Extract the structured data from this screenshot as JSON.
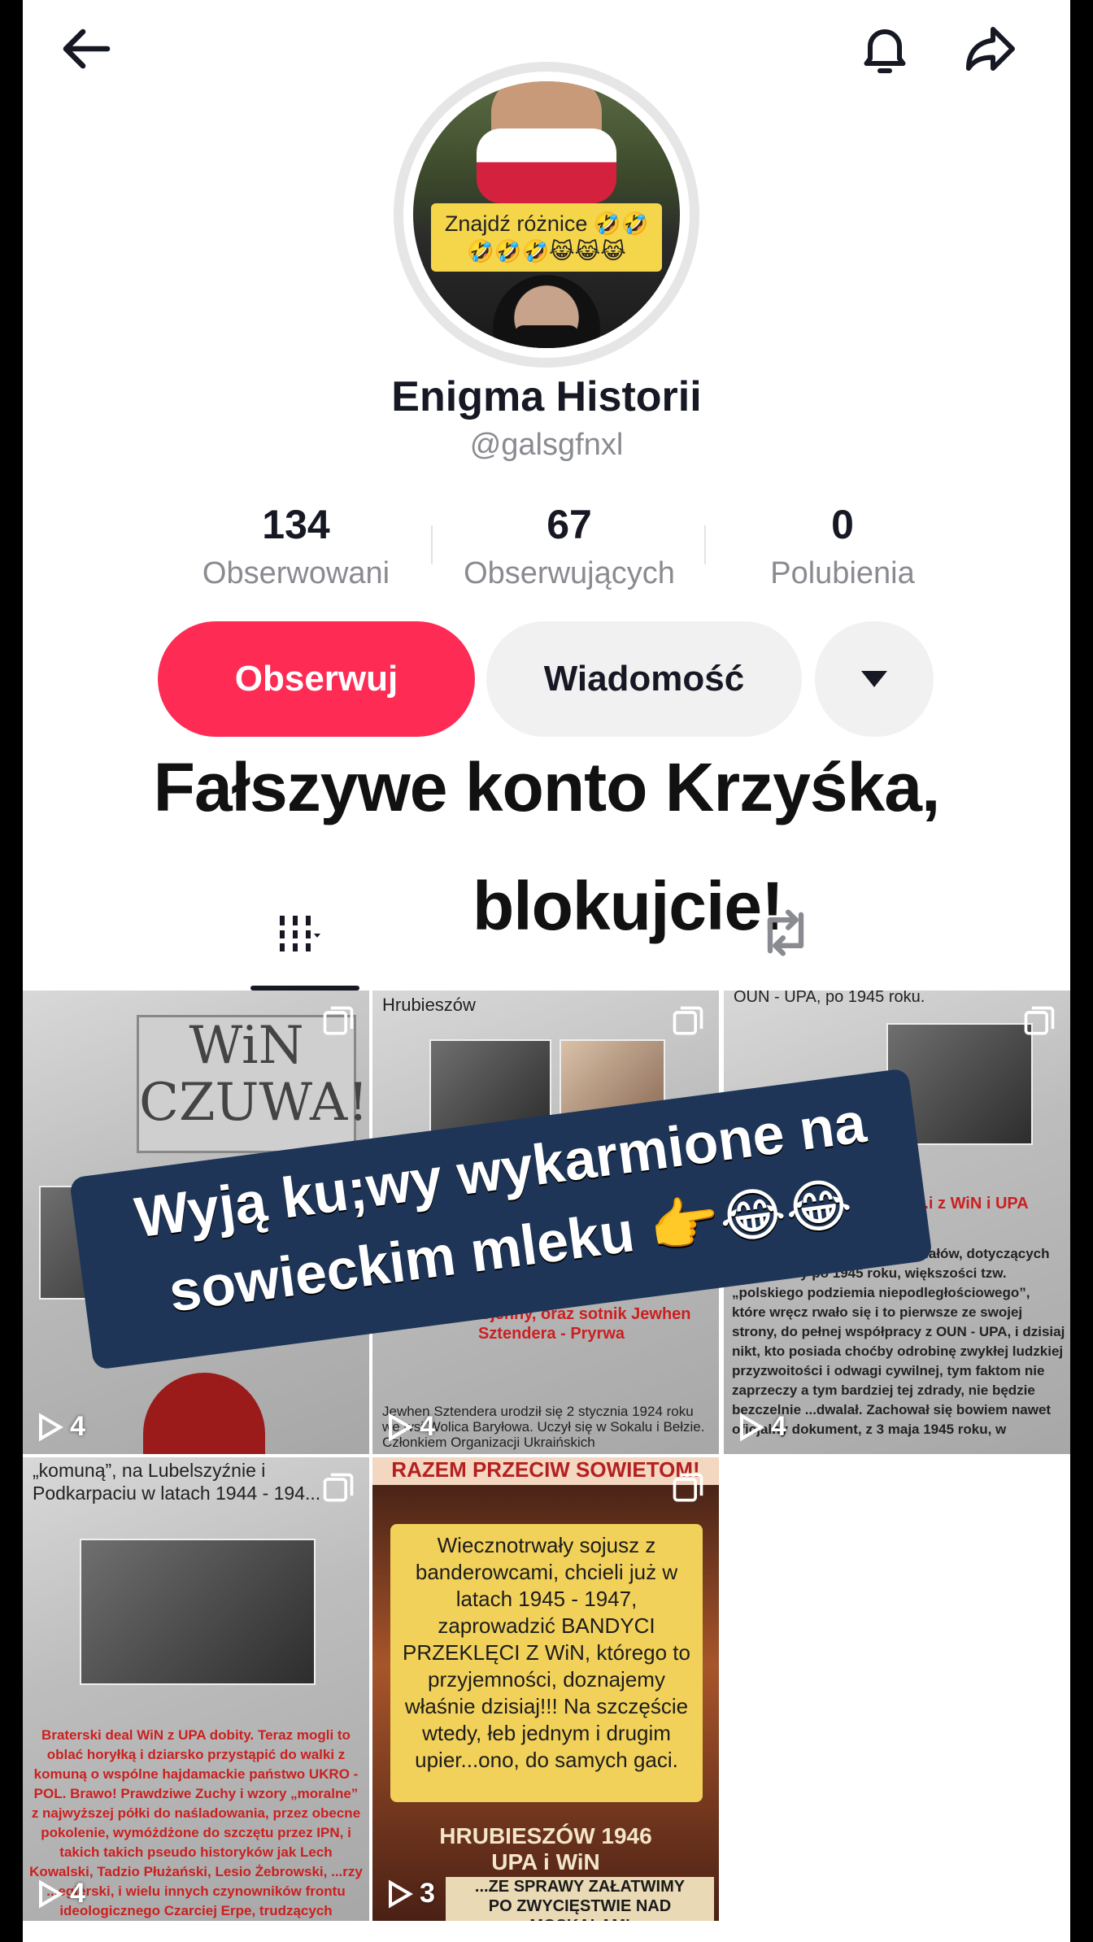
{
  "header": {
    "back_icon": "arrow-left-icon",
    "bell_icon": "bell-icon",
    "share_icon": "share-arrow-icon"
  },
  "profile": {
    "name": "Enigma Historii",
    "handle": "@galsgfnxl",
    "avatar_caption_line1": "Znajdź różnice 🤣🤣",
    "avatar_caption_line2": "🤣🤣🤣😹😹😹"
  },
  "stats": [
    {
      "value": "134",
      "label": "Obserwowani"
    },
    {
      "value": "67",
      "label": "Obserwujących"
    },
    {
      "value": "0",
      "label": "Polubienia"
    }
  ],
  "actions": {
    "follow_label": "Obserwuj",
    "message_label": "Wiadomość",
    "more_icon": "triangle-down-icon"
  },
  "bio_overlay": {
    "line1": "Fałszywe konto Krzyśka,",
    "line2": "blokujcie!"
  },
  "tabs": {
    "videos_icon": "grid-icon",
    "repost_icon": "repost-icon"
  },
  "caption_overlay": {
    "line1": "Wyją ku;wy wykarmione na",
    "line2": "sowieckim mleku 👉😂😂"
  },
  "videos": [
    {
      "count": "4",
      "sign_text": "WiN CZUWA!",
      "text": ""
    },
    {
      "count": "4",
      "top_text": "Hrubieszów",
      "red_text": "...marz wojenny, oraz sotnik Jewhen Sztendera - Pryrwa",
      "text": "Jewhen Sztendera urodził się 2 stycznia 1924 roku we wsi Wolica Baryłowa. Uczył się w Sokalu i Bełzie. Członkiem Organizacji Ukraińskich"
    },
    {
      "count": "4",
      "top_text": "OUN - UPA, po 1945 roku.",
      "red_text": "...i z WiN i UPA",
      "text": "...kerecie jest mnóstwo materiałów, dotyczących współpracy po 1945 roku, większości tzw. „polskiego podziemia niepodległościowego”, które wręcz rwało się i to pierwsze ze swojej strony, do pełnej współpracy z OUN - UPA, i dzisiaj nikt, kto posiada choćby odrobinę zwykłej ludzkiej przyzwoitości i odwagi cywilnej, tym faktom nie zaprzeczy a tym bardziej tej zdrady, nie będzie bezczelnie ...dwalał. Zachował się bowiem nawet oficjalny dokument, z 3 maja 1945 roku, w"
    },
    {
      "count": "4",
      "top_text": "„komuną”, na Lubelszyźnie i Podkarpaciu w latach 1944 - 194...",
      "red_text": "Braterski deal WiN z UPA dobity. Teraz mogli to oblać horyłką i dziarsko przystąpić do walki z komuną o wspólne hajdamackie państwo UKRO - POL. Brawo! Prawdziwe Zuchy i wzory „moralne” z najwyższej półki do naśladowania, przez obecne pokolenie, wymóżdżone do szczętu przez IPN, i takich takich pseudo historyków jak Lech Kowalski, Tadzio Płużański, Lesio Żebrowski, ...rzy ...egierski, i wielu innych czynowników frontu ideologicznego Czarciej Erpe, trudzących"
    },
    {
      "count": "3",
      "banner": "RAZEM PRZECIW SOWIETOM!",
      "box_text": "Wiecznotrwały sojusz z banderowcami, chcieli już w latach 1945 - 1947, zaprowadzić BANDYCI PRZEKLĘCI Z WiN, którego to przyjemności, doznajemy właśnie dzisiaj!!! Na szczęście wtedy, łeb jednym i drugim upier...ono, do samych gaci.",
      "title_line1": "HRUBIESZÓW 1946",
      "title_line2": "UPA i WiN",
      "footer_line1": "...ZE SPRAWY ZAŁATWIMY",
      "footer_line2": "PO ZWYCIĘSTWIE NAD MOSKALAMI"
    }
  ],
  "colors": {
    "follow_button": "#fe2c55",
    "secondary_button": "#f1f1f2",
    "caption_bg": "#1e3558",
    "muted_text": "#8a8b91"
  }
}
